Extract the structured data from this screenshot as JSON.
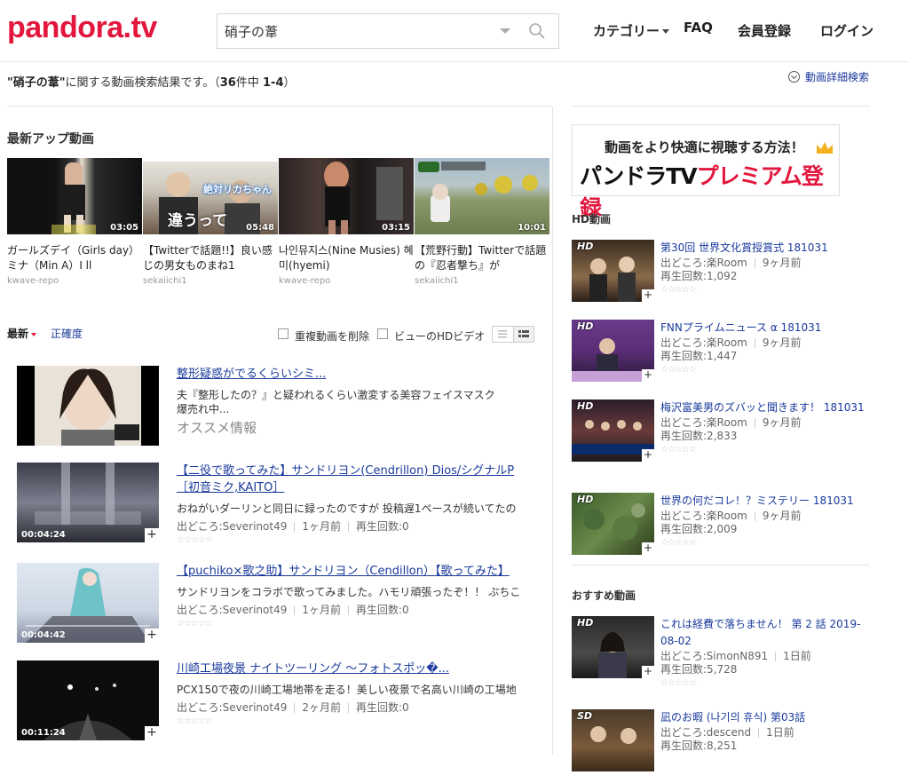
{
  "header": {
    "logo": "pandora.tv",
    "search_value": "硝子の葦",
    "nav": {
      "category": "カテゴリー",
      "faq": "FAQ",
      "register": "会員登録",
      "login": "ログイン"
    }
  },
  "results": {
    "query_quoted": "\"硝子の葦\"",
    "text_mid": "に関する動画検索結果です。（",
    "total": "36",
    "text_count": "件中",
    "range": "1-4",
    "text_end": "）",
    "detail_search": "動画詳細検索"
  },
  "latest": {
    "title": "最新アップ動画",
    "items": [
      {
        "name": "ガールズデイ（Girls day）ミナ（Min A）I ll",
        "user": "kwave-repo",
        "duration": "03:05",
        "color": "#1c1c1c"
      },
      {
        "name": "【Twitterで話題!!】良い感じの男女ものまね1",
        "user": "sekaiichi1",
        "duration": "05:48",
        "color": "#5a4a3a",
        "overlay_top": "絶対リカちゃん",
        "overlay_bottom": "違うって"
      },
      {
        "name": "나인뮤지스(Nine Musies) 혜미(hyemi)",
        "user": "kwave-repo",
        "duration": "03:15",
        "color": "#2a2525"
      },
      {
        "name": "【荒野行動】Twitterで話題の『忍者撃ち』が",
        "user": "sekaiichi1",
        "duration": "10:01",
        "color": "#7a8a6a"
      }
    ]
  },
  "sort": {
    "newest": "最新",
    "accuracy": "正確度",
    "dedupe": "重複動画を削除",
    "hd_only": "ビューのHDビデオ"
  },
  "list": [
    {
      "title": "整形疑惑がでるくらいシミ...",
      "desc": "夫『整形したの？』と疑われるくらい激変する美容フェイスマスク爆売れ中...",
      "ad": "オススメ情報"
    },
    {
      "title": "【二役で歌ってみた】サンドリヨン(Cendrillon) Dios/シグナルP［初音ミク,KAITO］",
      "desc": "おねがいダーリンと同日に録ったのですが 投稿遅1ペースが続いてたの",
      "source": "出どころ:Severinot49",
      "ago": "1ヶ月前",
      "plays": "再生回数:0",
      "duration": "00:04:24"
    },
    {
      "title": "【puchiko×歌之助】サンドリヨン（Cendillon）【歌ってみた】",
      "desc": "サンドリヨンをコラボで歌ってみました。ハモリ頑張ったぞ！！ ぷちこ",
      "source": "出どころ:Severinot49",
      "ago": "1ヶ月前",
      "plays": "再生回数:0",
      "duration": "00:04:42"
    },
    {
      "title": "川崎工場夜景 ナイトツーリング ～フォトスポッ�...",
      "desc": "PCX150で夜の川崎工場地帯を走る！美しい夜景で名高い川崎の工場地",
      "source": "出どころ:Severinot49",
      "ago": "2ヶ月前",
      "plays": "再生回数:0",
      "duration": "00:11:24"
    }
  ],
  "premium": {
    "line1": "動画をより快適に視聴する方法！",
    "line2_black": "パンドラTV",
    "line2_red": "プレミアム登録"
  },
  "hd": {
    "title": "HD動画",
    "items": [
      {
        "title": "第30回 世界文化賞授賞式 181031",
        "source": "出どころ:楽Room",
        "ago": "9ヶ月前",
        "plays": "再生回数:1,092",
        "badge": "HD"
      },
      {
        "title": "FNNプライムニュース α 181031",
        "source": "出どころ:楽Room",
        "ago": "9ヶ月前",
        "plays": "再生回数:1,447",
        "badge": "HD"
      },
      {
        "title": "梅沢富美男のズバッと聞きます！ 181031",
        "source": "出どころ:楽Room",
        "ago": "9ヶ月前",
        "plays": "再生回数:2,833",
        "badge": "HD"
      },
      {
        "title": "世界の何だコレ！？ミステリー 181031",
        "source": "出どころ:楽Room",
        "ago": "9ヶ月前",
        "plays": "再生回数:2,009",
        "badge": "HD"
      }
    ]
  },
  "recommend": {
    "title": "おすすめ動画",
    "items": [
      {
        "title": "これは経費で落ちません！ 第 2 話 2019-08-02",
        "source": "出どころ:SimonN891",
        "ago": "1日前",
        "plays": "再生回数:5,728",
        "badge": "HD"
      },
      {
        "title": "凪のお暇 (나기의 휴식) 第03話",
        "source": "出どころ:descend",
        "ago": "1日前",
        "plays": "再生回数:8,251",
        "badge": "SD"
      }
    ]
  },
  "stars": "☆☆☆☆☆",
  "colors": {
    "brand": "#e3173d",
    "link": "#1a3a9c"
  }
}
